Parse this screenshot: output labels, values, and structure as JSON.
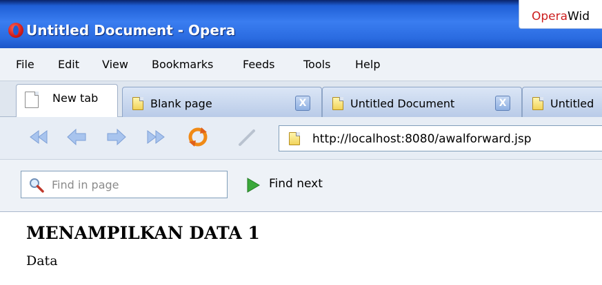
{
  "window": {
    "title": "Untitled Document - Opera",
    "widgets_tab": {
      "brand": "Opera",
      "label": "Wid"
    }
  },
  "menu": [
    "File",
    "Edit",
    "View",
    "Bookmarks",
    "Feeds",
    "Tools",
    "Help"
  ],
  "tabs": [
    {
      "label": "New tab",
      "icon": "new-tab-icon",
      "active": true
    },
    {
      "label": "Blank page",
      "icon": "page-icon",
      "close": "X"
    },
    {
      "label": "Untitled Document",
      "icon": "page-icon",
      "close": "X"
    },
    {
      "label": "Untitled",
      "icon": "page-icon"
    }
  ],
  "toolbar": {
    "buttons": [
      "rewind-icon",
      "back-arrow-icon",
      "forward-arrow-icon",
      "fast-forward-icon",
      "reload-icon",
      "edit-pencil-icon"
    ],
    "address": "http://localhost:8080/awalforward.jsp"
  },
  "find": {
    "placeholder": "Find in page",
    "next_label": "Find next"
  },
  "page": {
    "heading": "MENAMPILKAN DATA 1",
    "text": "Data"
  },
  "colors": {
    "titlebar": "#2a6be0",
    "menubar": "#eef2f7",
    "accent_red": "#cc1d1d",
    "nav_arrows": "#9bbcec",
    "reload_orange": "#f08a16"
  }
}
